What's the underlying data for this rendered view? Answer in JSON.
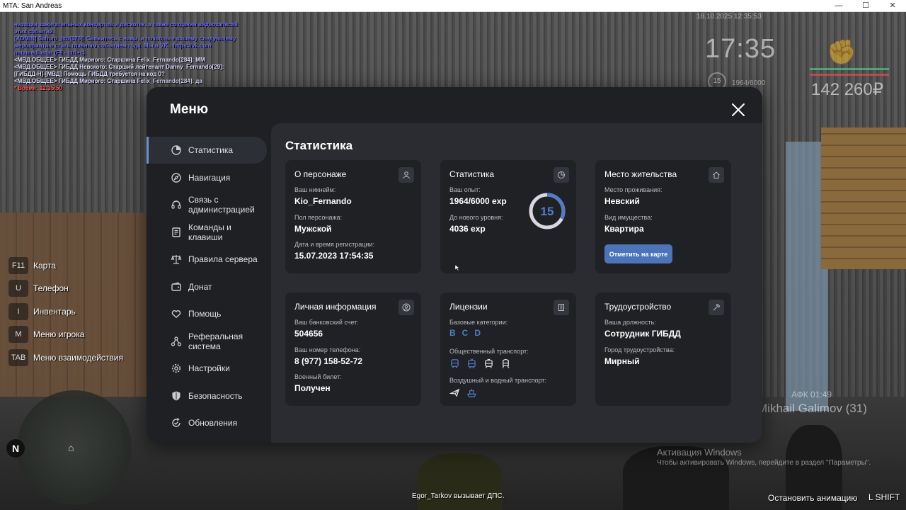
{
  "window": {
    "title": "MTA: San Andreas"
  },
  "chat": [
    {
      "text": "низации зажигательных концертов и дискотек, а также создании видеозаписей",
      "style": "blue"
    },
    {
      "text": "  этих событий.",
      "style": "blue"
    },
    {
      "text": "[ADMIN] Sahoro_Itto[176]: Свяжитесь с нами, и позвольте вашему следующему",
      "style": "blue"
    },
    {
      "text": "мероприятию стать главным событием года. Мы в VK - https://vk.com",
      "style": "blue"
    },
    {
      "text": "/mtamediastar (F8 - ctrl+c).",
      "style": "blue"
    },
    {
      "text": "<МВД.ОБЩЕЕ> ГИБДД Мирного: Старшина Felix_Fernando[284]: ММ",
      "style": "white"
    },
    {
      "text": "<МВД.ОБЩЕЕ> ГИБДД Невского: Старший лейтенант Danny_Fernando[29]:",
      "style": "white"
    },
    {
      "text": "[ГИБДД-Н]-[МВД] Помощь ГИБДД требуется на код 0?",
      "style": "white"
    },
    {
      "text": "<МВД.ОБЩЕЕ> ГИБДД Мирного: Старшина Felix_Fernando[284]: да",
      "style": "white"
    },
    {
      "text": "* Время: 12:35:50",
      "style": "red"
    }
  ],
  "hud": {
    "date": "18.10.2025 12:35:53",
    "time": "17:35",
    "level": "15",
    "exp": "1964/6000",
    "money": "142 260₽"
  },
  "hotkeys": [
    {
      "key": "F11",
      "label": "Карта"
    },
    {
      "key": "U",
      "label": "Телефон"
    },
    {
      "key": "I",
      "label": "Инвентарь"
    },
    {
      "key": "M",
      "label": "Меню игрока"
    },
    {
      "key": "TAB",
      "label": "Меню взаимодействия"
    }
  ],
  "radar": {
    "north": "N"
  },
  "bottom": {
    "afk": "АФК 01:49",
    "nametag": "Mikhail Galimov (31)",
    "windows_activation_title": "Активация Windows",
    "windows_activation_text": "Чтобы активировать Windows, перейдите в раздел \"Параметры\".",
    "call_message": "Egor_Tarkov вызывает ДПС.",
    "stop_animation": "Остановить анимацию",
    "stop_key": "L SHIFT"
  },
  "menu": {
    "title": "Меню",
    "sidebar": [
      {
        "label": "Статистика",
        "icon": "pie-chart-icon",
        "active": true
      },
      {
        "label": "Навигация",
        "icon": "compass-icon"
      },
      {
        "label": "Связь с администрацией",
        "icon": "headset-icon"
      },
      {
        "label": "Команды и клавиши",
        "icon": "document-icon"
      },
      {
        "label": "Правила сервера",
        "icon": "scales-icon"
      },
      {
        "label": "Донат",
        "icon": "wallet-icon"
      },
      {
        "label": "Помощь",
        "icon": "hand-heart-icon"
      },
      {
        "label": "Реферальная система",
        "icon": "referral-icon"
      },
      {
        "label": "Настройки",
        "icon": "gear-icon"
      },
      {
        "label": "Безопасность",
        "icon": "shield-icon"
      },
      {
        "label": "Обновления",
        "icon": "refresh-icon"
      }
    ],
    "content_title": "Статистика",
    "cards": {
      "character": {
        "title": "О персонаже",
        "nick_label": "Ваш никнейм:",
        "nick": "Kio_Fernando",
        "gender_label": "Пол персонажа:",
        "gender": "Мужской",
        "reg_label": "Дата и время регистрации:",
        "reg": "15.07.2023 17:54:35"
      },
      "stats": {
        "title": "Статистика",
        "exp_label": "Ваш опыт:",
        "exp": "1964/6000 exp",
        "next_label": "До нового уровня:",
        "next": "4036 exp",
        "level": "15",
        "progress": 0.327
      },
      "residence": {
        "title": "Место жительства",
        "place_label": "Место проживания:",
        "place": "Невский",
        "property_label": "Вид имущества:",
        "property": "Квартира",
        "map_button": "Отметить на карте"
      },
      "personal": {
        "title": "Личная информация",
        "bank_label": "Ваш банковский счет:",
        "bank": "504656",
        "phone_label": "Ваш номер телефона:",
        "phone": "8 (977) 158-52-72",
        "military_label": "Военный билет:",
        "military": "Получен"
      },
      "licenses": {
        "title": "Лицензии",
        "base_label": "Базовые категории:",
        "categories": [
          "B",
          "C",
          "D"
        ],
        "public_label": "Общественный транспорт:",
        "public_icons": [
          "bus-icon",
          "trolleybus-icon",
          "tram-icon",
          "train-icon"
        ],
        "air_label": "Воздушный и водный транспорт:",
        "air_icons": [
          "airplane-icon",
          "ship-icon"
        ]
      },
      "employment": {
        "title": "Трудоустройство",
        "position_label": "Ваша должность:",
        "position": "Сотрудник ГИБДД",
        "city_label": "Город трудоустройства:",
        "city": "Мирный"
      }
    }
  },
  "colors": {
    "accent": "#4f7dc9",
    "button": "#4d74b8",
    "menu_bg": "#1e2024",
    "content_bg": "#2a2c31",
    "card_bg": "#1f2125"
  }
}
